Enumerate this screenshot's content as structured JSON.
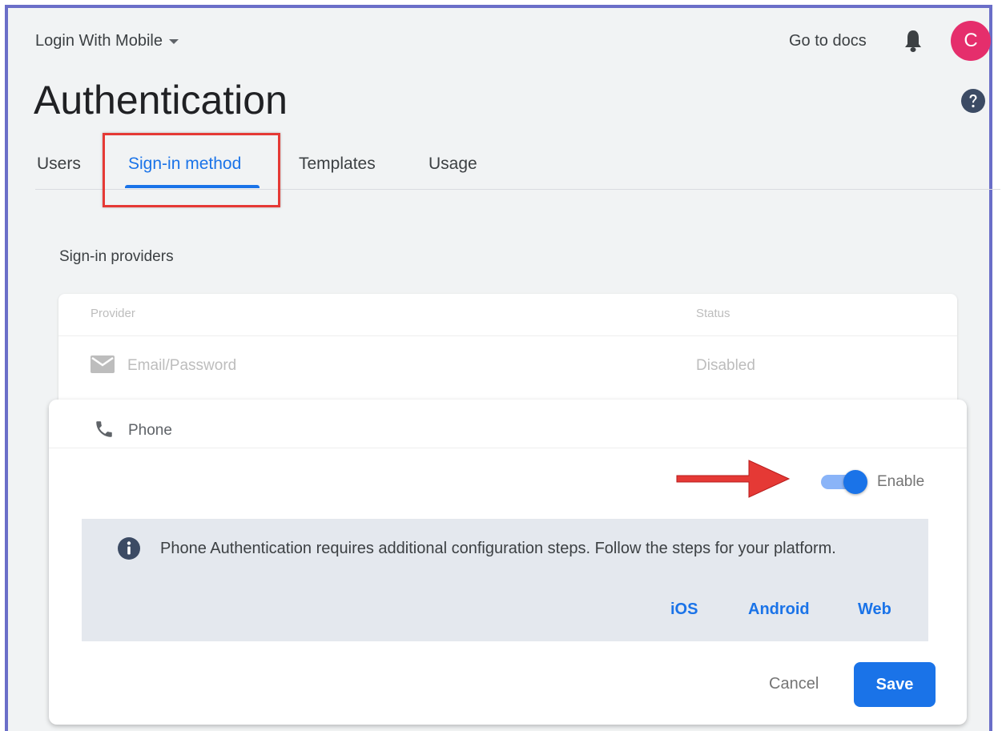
{
  "header": {
    "project_name": "Login With Mobile",
    "docs_link": "Go to docs",
    "avatar_initial": "C"
  },
  "page": {
    "title": "Authentication"
  },
  "tabs": [
    {
      "label": "Users",
      "active": false
    },
    {
      "label": "Sign-in method",
      "active": true
    },
    {
      "label": "Templates",
      "active": false
    },
    {
      "label": "Usage",
      "active": false
    }
  ],
  "providers_section": {
    "title": "Sign-in providers",
    "columns": {
      "provider": "Provider",
      "status": "Status"
    },
    "rows": [
      {
        "provider": "Email/Password",
        "status": "Disabled",
        "icon": "mail-icon"
      }
    ]
  },
  "phone_panel": {
    "provider": "Phone",
    "icon": "phone-icon",
    "enable_label": "Enable",
    "enabled": true,
    "info_text": "Phone Authentication requires additional configuration steps. Follow the steps for your platform.",
    "links": [
      "iOS",
      "Android",
      "Web"
    ],
    "cancel_label": "Cancel",
    "save_label": "Save"
  },
  "colors": {
    "accent": "#1a73e8",
    "avatar": "#e52e6c",
    "annotation_red": "#e53935",
    "frame_border": "#6a6ec8"
  }
}
